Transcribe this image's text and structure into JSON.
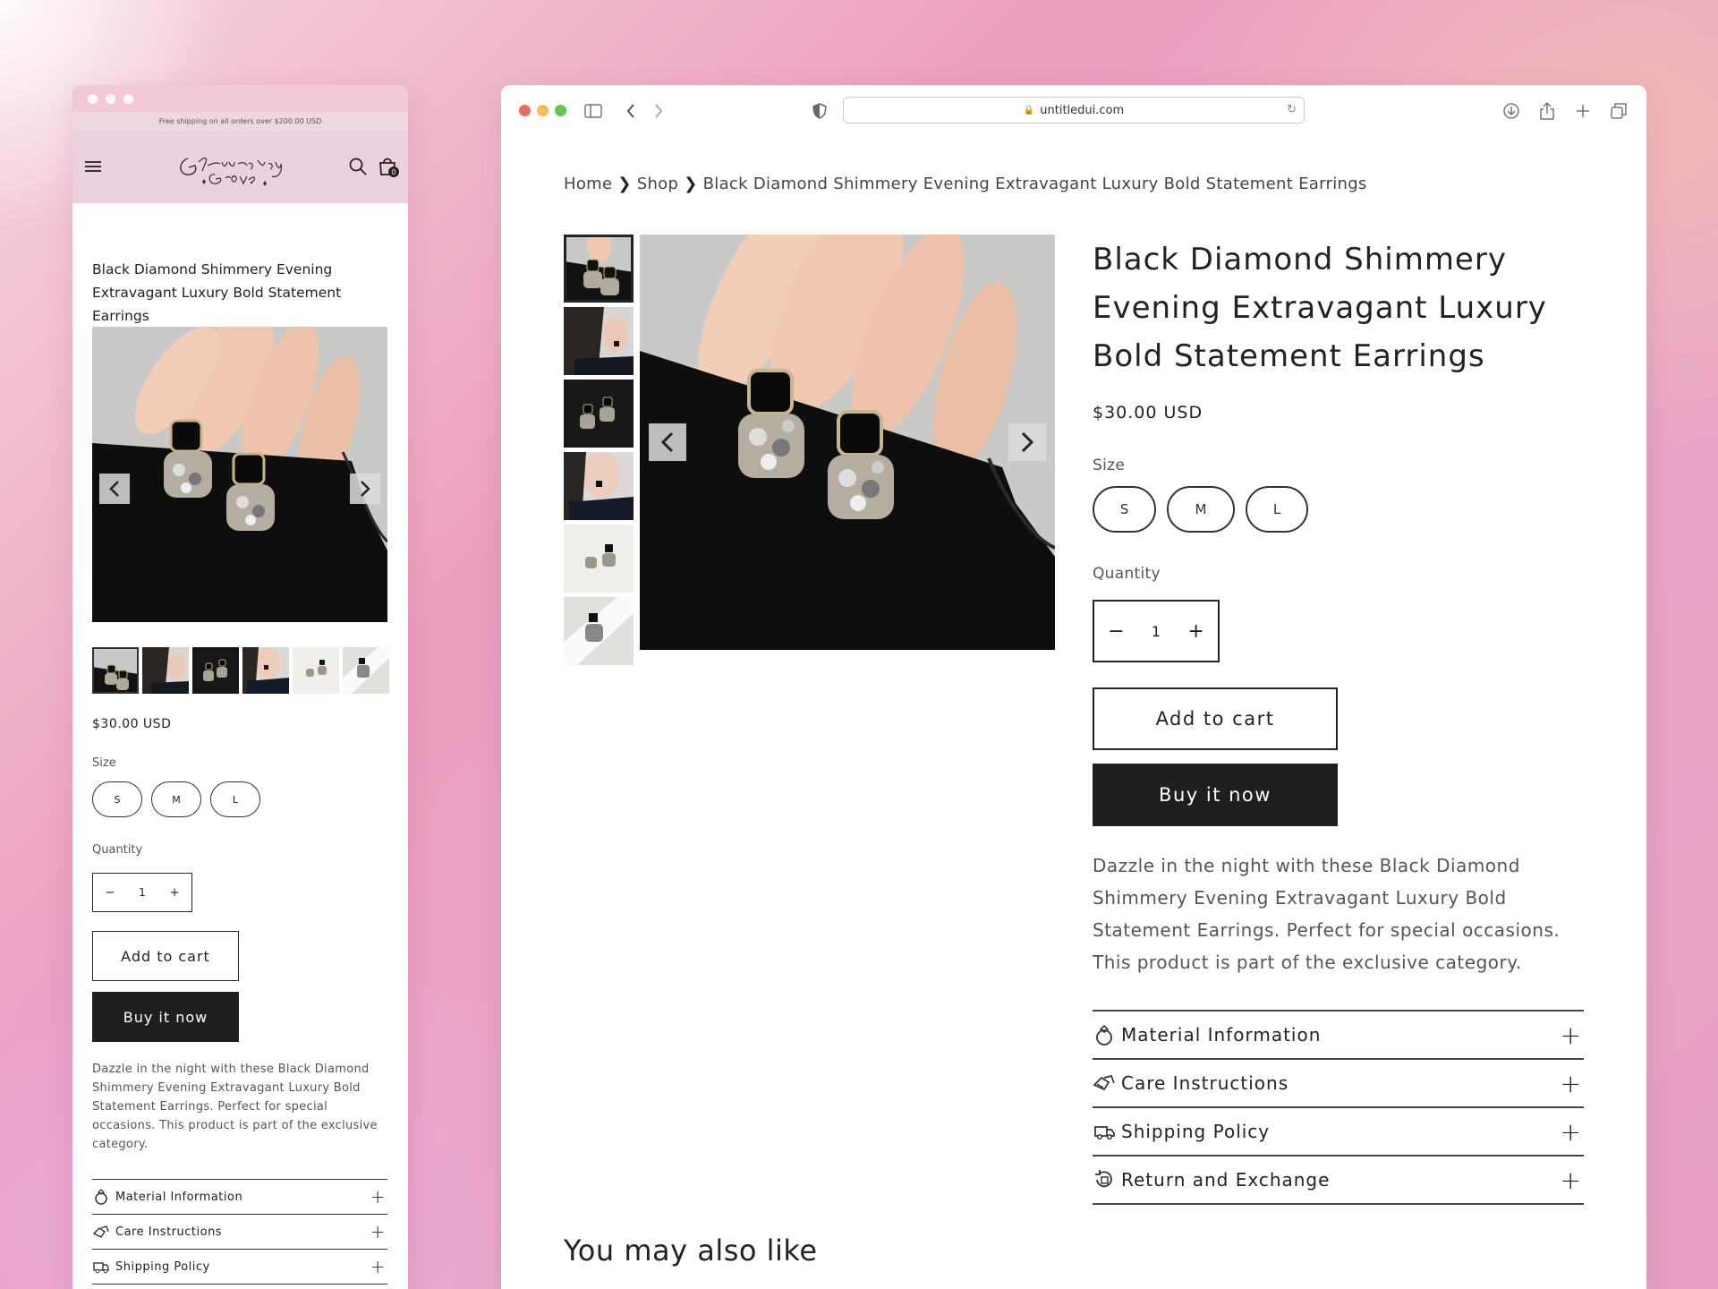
{
  "mobile": {
    "announcement": "Free shipping on all orders over $200.00 USD",
    "cart_count": "0",
    "title": "Black Diamond Shimmery Evening Extravagant Luxury Bold Statement Earrings",
    "price": "$30.00 USD",
    "size_label": "Size",
    "sizes": [
      "S",
      "M",
      "L"
    ],
    "quantity_label": "Quantity",
    "qty_minus": "−",
    "qty_value": "1",
    "qty_plus": "+",
    "add_to_cart": "Add to cart",
    "buy_now": "Buy it now",
    "description": "Dazzle in the night with these Black Diamond Shimmery Evening Extravagant Luxury Bold Statement Earrings. Perfect for special occasions. This product is part of the exclusive category.",
    "accordion": [
      {
        "label": "Material Information",
        "icon": "ring-icon"
      },
      {
        "label": "Care Instructions",
        "icon": "care-icon"
      },
      {
        "label": "Shipping Policy",
        "icon": "truck-icon"
      }
    ],
    "plus": "+"
  },
  "browser": {
    "url": "untitledui.com"
  },
  "desktop": {
    "breadcrumb": {
      "home": "Home",
      "shop": "Shop",
      "current": "Black Diamond Shimmery Evening Extravagant Luxury Bold Statement Earrings",
      "sep": "❯"
    },
    "title": "Black Diamond Shimmery Evening Extravagant Luxury Bold Statement Earrings",
    "price": "$30.00 USD",
    "size_label": "Size",
    "sizes": [
      "S",
      "M",
      "L"
    ],
    "quantity_label": "Quantity",
    "qty_minus": "−",
    "qty_value": "1",
    "qty_plus": "+",
    "add_to_cart": "Add to cart",
    "buy_now": "Buy it now",
    "description": "Dazzle in the night with these Black Diamond Shimmery Evening Extravagant Luxury Bold Statement Earrings. Perfect for special occasions. This product is part of the exclusive category.",
    "accordion": [
      {
        "label": "Material Information",
        "icon": "ring-icon"
      },
      {
        "label": "Care Instructions",
        "icon": "care-icon"
      },
      {
        "label": "Shipping Policy",
        "icon": "truck-icon"
      },
      {
        "label": "Return and Exchange",
        "icon": "return-icon"
      }
    ],
    "plus": "+",
    "also_like": "You may also like"
  },
  "colors": {
    "dark_button": "#1f1f1f",
    "announcement_bg": "#efd6e0",
    "header_bg": "#ecd2de",
    "traffic_red": "#ed6a5e",
    "traffic_yellow": "#f4bf4f",
    "traffic_green": "#61c554"
  }
}
